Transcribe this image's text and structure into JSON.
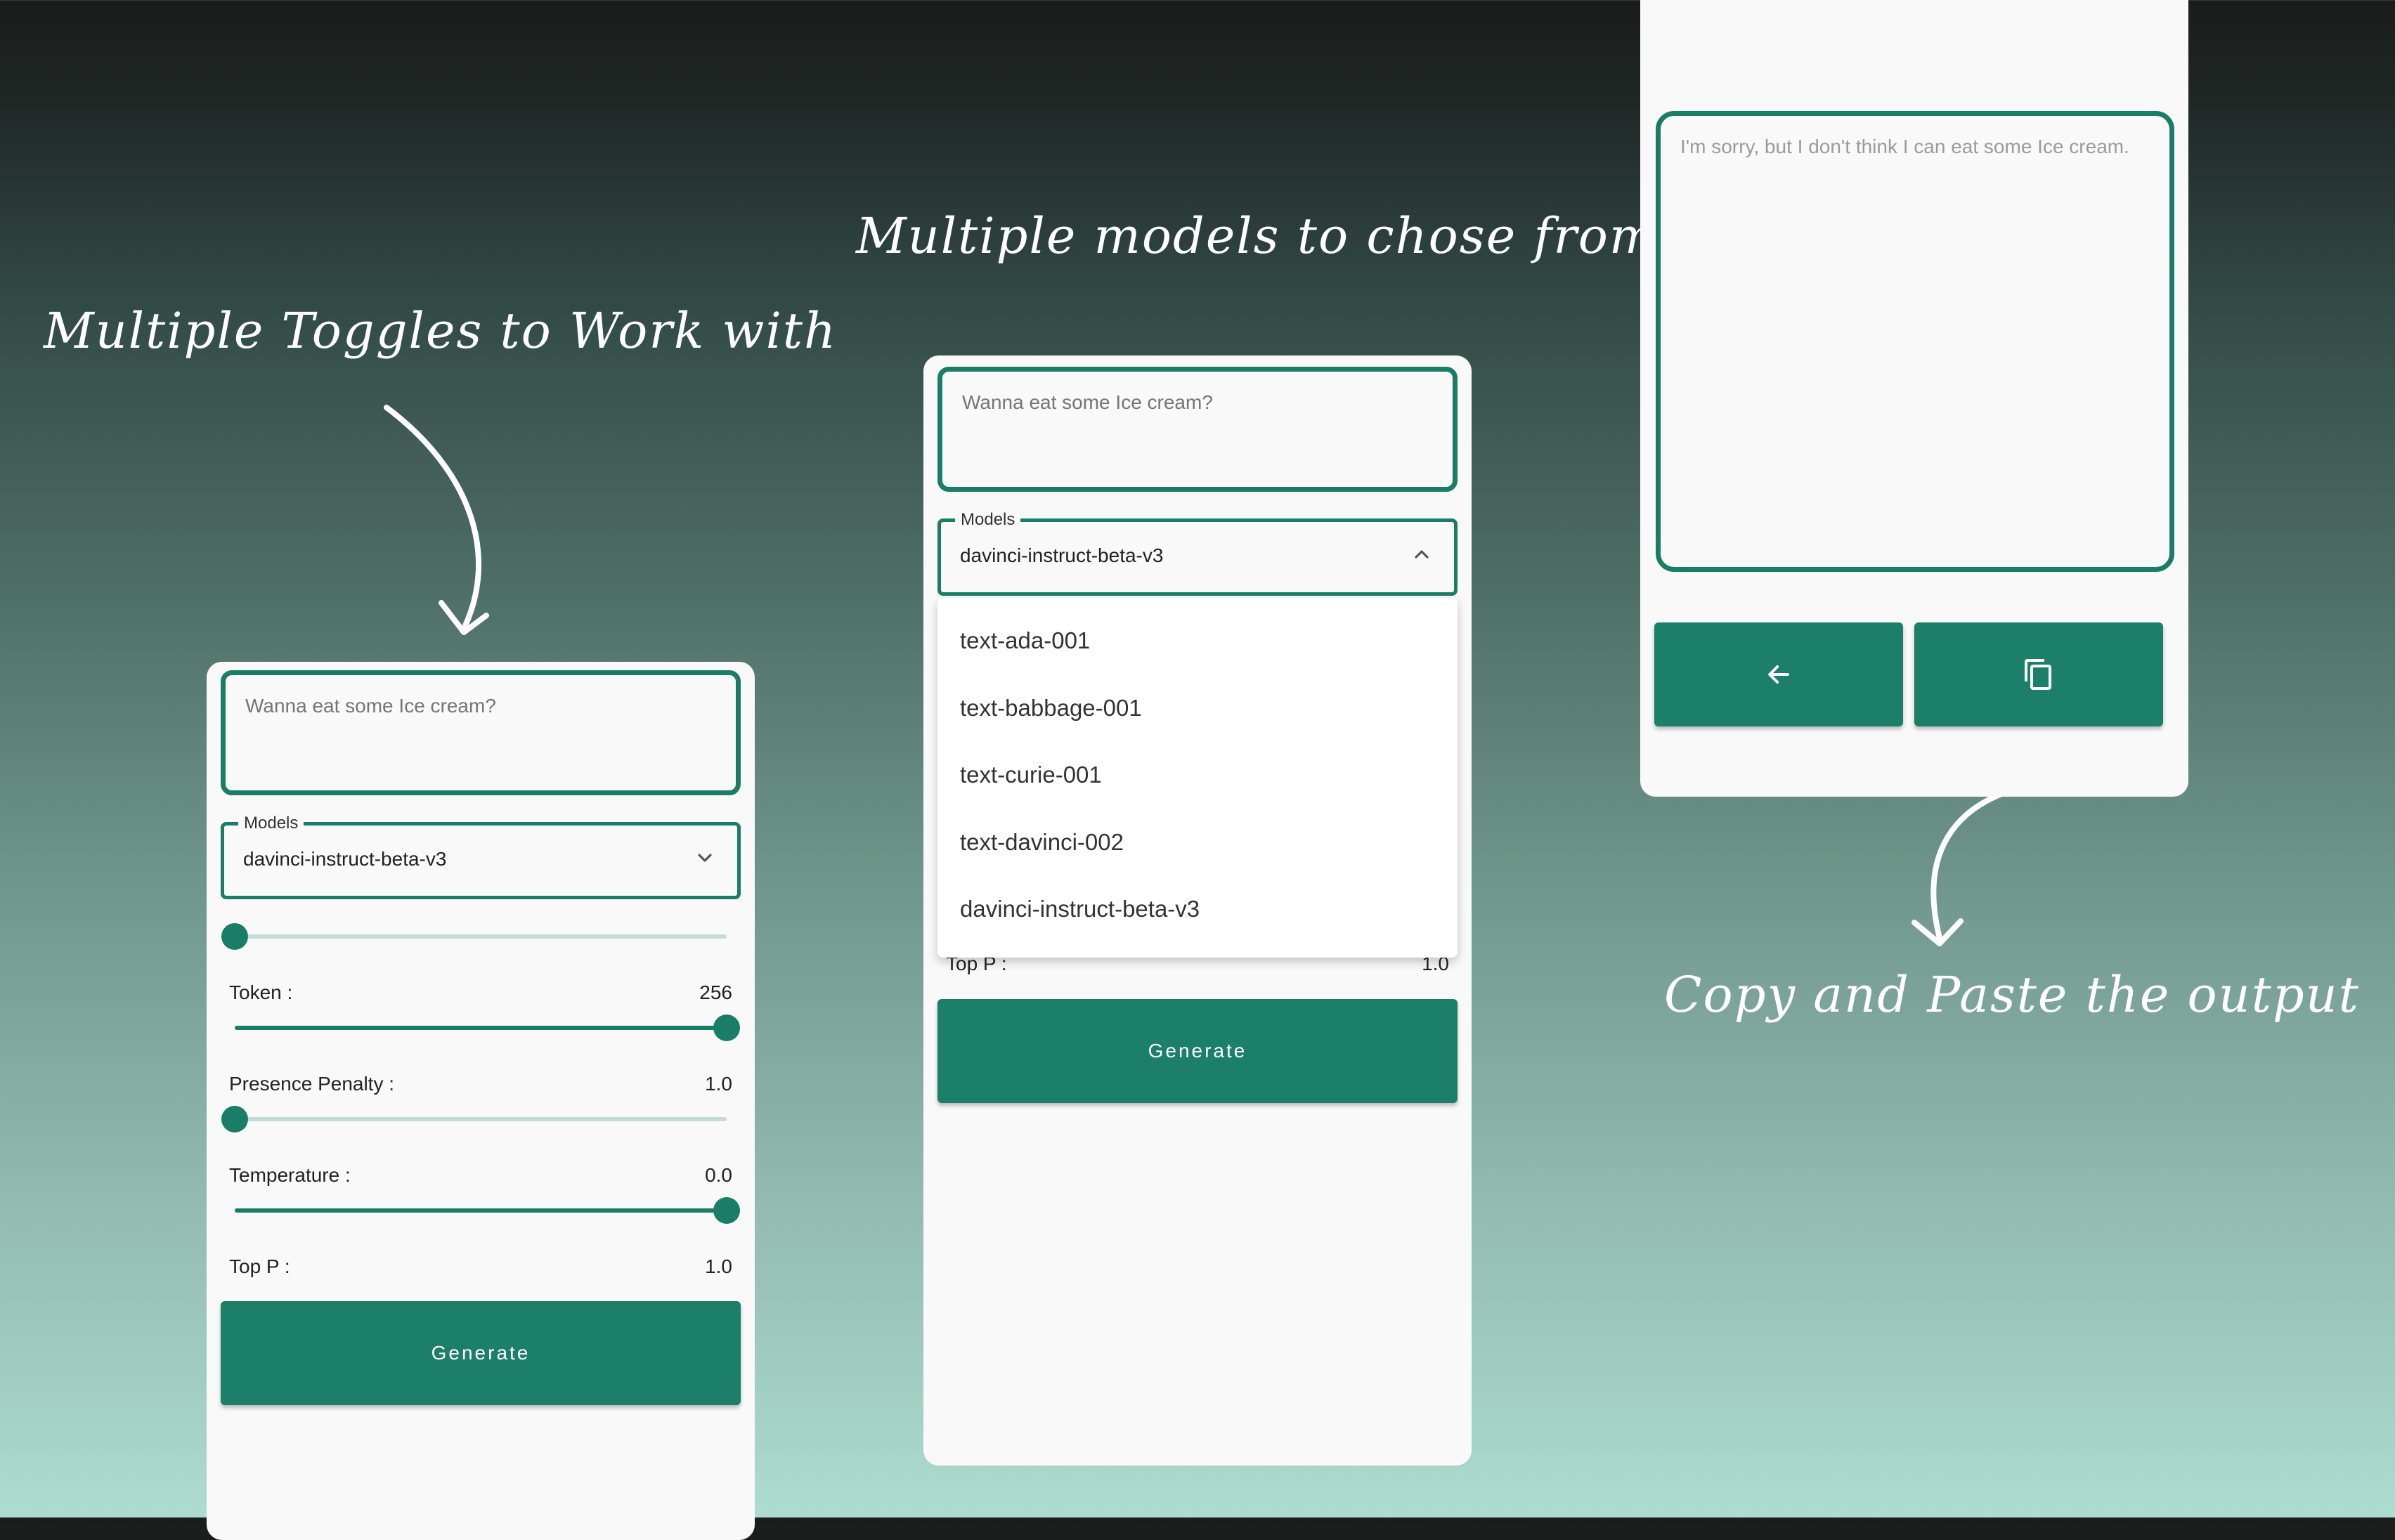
{
  "captions": {
    "toggles": "Multiple Toggles to Work with",
    "models": "Multiple models to chose from",
    "copy": "Copy and Paste the output"
  },
  "colors": {
    "accent": "#1b7f69",
    "panel": "#f9f9f9"
  },
  "left_panel": {
    "prompt_placeholder": "Wanna eat some Ice cream?",
    "models_label": "Models",
    "selected_model": "davinci-instruct-beta-v3",
    "sliders": [
      {
        "label": "Token :",
        "value": "256",
        "fraction": 0.0
      },
      {
        "label": "Presence Penalty :",
        "value": "1.0",
        "fraction": 1.0
      },
      {
        "label": "Temperature :",
        "value": "0.0",
        "fraction": 0.0
      },
      {
        "label": "Top P :",
        "value": "1.0",
        "fraction": 1.0
      }
    ],
    "generate_label": "Generate"
  },
  "middle_panel": {
    "prompt_placeholder": "Wanna eat some Ice cream?",
    "models_label": "Models",
    "selected_model": "davinci-instruct-beta-v3",
    "options": [
      "text-ada-001",
      "text-babbage-001",
      "text-curie-001",
      "text-davinci-002",
      "davinci-instruct-beta-v3"
    ],
    "top_p_label": "Top P :",
    "top_p_value": "1.0",
    "generate_label": "Generate"
  },
  "right_panel": {
    "output_text": "I'm sorry, but I don't think I can eat some Ice cream.",
    "back_icon": "arrow-left-icon",
    "copy_icon": "copy-icon"
  }
}
